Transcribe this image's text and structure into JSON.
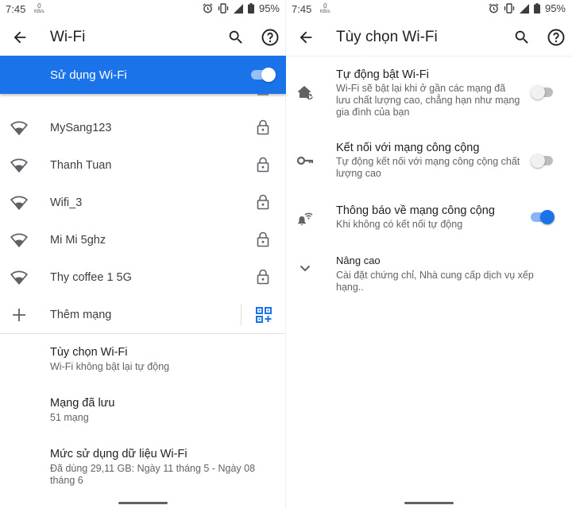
{
  "status": {
    "time": "7:45",
    "kbs_value": "0",
    "kbs_unit": "KB/s",
    "battery": "95%"
  },
  "wifi_screen": {
    "title": "Wi-Fi",
    "use_wifi_label": "Sử dụng Wi-Fi",
    "use_wifi_on": true,
    "networks": [
      {
        "name": "MySang123",
        "locked": true
      },
      {
        "name": "Thanh Tuan",
        "locked": true
      },
      {
        "name": "Wifi_3",
        "locked": true
      },
      {
        "name": "Mi Mi 5ghz",
        "locked": true
      },
      {
        "name": "Thy coffee 1 5G",
        "locked": true
      }
    ],
    "add_network_label": "Thêm mạng",
    "prefs": [
      {
        "title": "Tùy chọn Wi-Fi",
        "summary": "Wi-Fi không bật lại tự động"
      },
      {
        "title": "Mạng đã lưu",
        "summary": "51 mạng"
      },
      {
        "title": "Mức sử dụng dữ liệu Wi-Fi",
        "summary": "Đã dùng 29,11 GB: Ngày 11 tháng 5 - Ngày 08 tháng 6"
      }
    ]
  },
  "options_screen": {
    "title": "Tùy chọn Wi-Fi",
    "options": [
      {
        "title": "Tự động bật Wi-Fi",
        "summary": "Wi-Fi sẽ bật lại khi ở gần các mạng đã lưu chất lượng cao, chẳng hạn như mạng gia đình của bạn",
        "icon": "home-wifi-icon",
        "enabled": false
      },
      {
        "title": "Kết nối với mạng công cộng",
        "summary": "Tự động kết nối với mạng công cộng chất lượng cao",
        "icon": "key-icon",
        "enabled": false
      },
      {
        "title": "Thông báo về mạng công cộng",
        "summary": "Khi không có kết nối tự động",
        "icon": "wifi-notification-icon",
        "enabled": true
      }
    ],
    "advanced": {
      "title": "Nâng cao",
      "summary": "Cài đặt chứng chỉ, Nhà cung cấp dịch vụ xếp hạng.."
    }
  },
  "colors": {
    "accent": "#1a73e8",
    "text_primary": "#202124",
    "text_secondary": "#5f6368"
  }
}
